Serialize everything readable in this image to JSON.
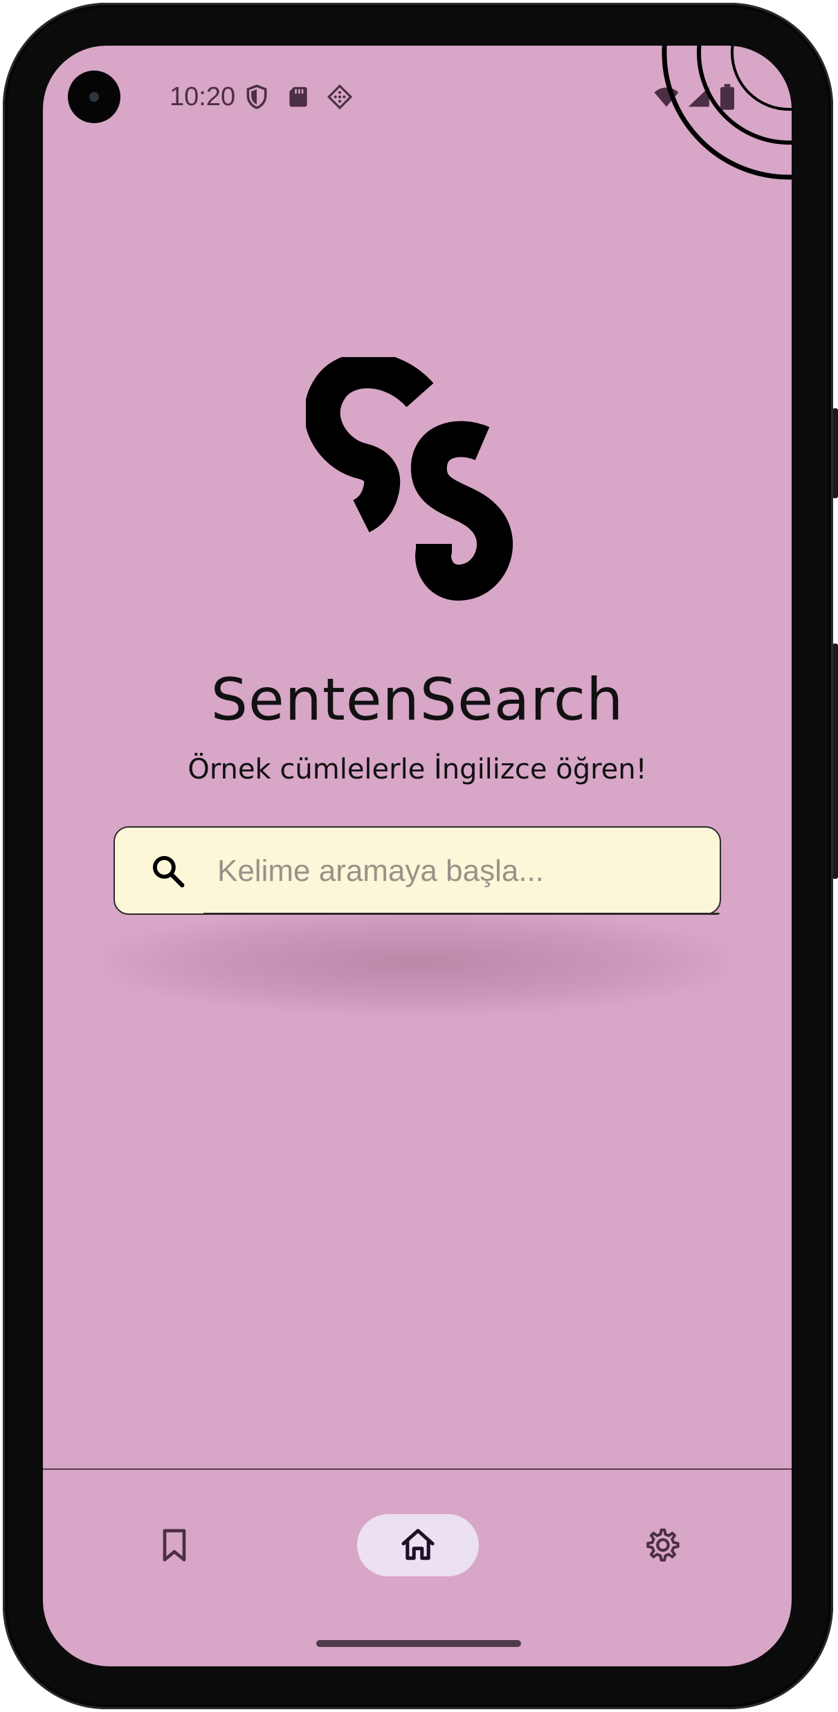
{
  "status_bar": {
    "time": "10:20",
    "left_icons": [
      "shield-icon",
      "sd-card-icon",
      "diamond-grid-icon"
    ],
    "right_icons": [
      "wifi-icon",
      "signal-icon",
      "battery-icon"
    ]
  },
  "app": {
    "logo_icon": "ss-logo-icon",
    "title": "SentenSearch",
    "subtitle": "Örnek cümlelerle İngilizce öğren!"
  },
  "search": {
    "icon": "search-icon",
    "placeholder": "Kelime aramaya başla...",
    "value": ""
  },
  "bottom_nav": {
    "items": [
      {
        "id": "bookmarks",
        "icon": "bookmark-icon",
        "active": false
      },
      {
        "id": "home",
        "icon": "home-icon",
        "active": true
      },
      {
        "id": "settings",
        "icon": "gear-icon",
        "active": false
      }
    ]
  },
  "colors": {
    "screen_background": "#d8a6c7",
    "search_background": "#fcf7d8",
    "active_nav_pill": "#ece0f3",
    "status_text": "#4b2f44",
    "text": "#111111"
  }
}
